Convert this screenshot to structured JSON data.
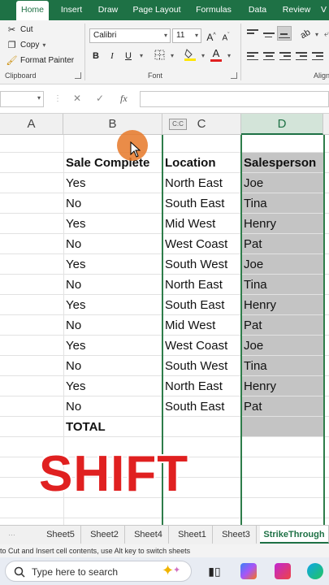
{
  "ribbon": {
    "tabs": [
      "Home",
      "Insert",
      "Draw",
      "Page Layout",
      "Formulas",
      "Data",
      "Review",
      "V"
    ],
    "active_tab": "Home",
    "clipboard": {
      "cut": "Cut",
      "copy": "Copy",
      "format_painter": "Format Painter",
      "label": "Clipboard"
    },
    "font": {
      "name": "Calibri",
      "size": "11",
      "label": "Font",
      "bold": "B",
      "italic": "I",
      "underline": "U",
      "grow": "A",
      "shrink": "A",
      "font_color": "A"
    },
    "alignment": {
      "label": "Align"
    },
    "colors": {
      "tabbar": "#1e7145",
      "font_color_bar": "#e02020",
      "highlight_bar": "#ffe600"
    }
  },
  "formula_bar": {
    "fx": "fx",
    "cancel": "✕",
    "enter": "✓",
    "value": ""
  },
  "columns": [
    "A",
    "B",
    "C",
    "D"
  ],
  "selected_column": "D",
  "paste_icon_label": "C:C",
  "table": {
    "headers": [
      "Sale Complete",
      "Location",
      "Salesperson"
    ],
    "rows": [
      [
        "Yes",
        "North East",
        "Joe"
      ],
      [
        "No",
        "South East",
        "Tina"
      ],
      [
        "Yes",
        "Mid West",
        "Henry"
      ],
      [
        "No",
        "West Coast",
        "Pat"
      ],
      [
        "Yes",
        "South West",
        "Joe"
      ],
      [
        "No",
        "North East",
        "Tina"
      ],
      [
        "Yes",
        "South East",
        "Henry"
      ],
      [
        "No",
        "Mid West",
        "Pat"
      ],
      [
        "Yes",
        "West Coast",
        "Joe"
      ],
      [
        "No",
        "South West",
        "Tina"
      ],
      [
        "Yes",
        "North East",
        "Henry"
      ],
      [
        "No",
        "South East",
        "Pat"
      ]
    ],
    "total_label": "TOTAL"
  },
  "overlay_caption": "SHIFT",
  "sheets": [
    "Sheet5",
    "Sheet2",
    "Sheet4",
    "Sheet1",
    "Sheet3",
    "StrikeThrough"
  ],
  "active_sheet": "StrikeThrough",
  "status_text": "to Cut and Insert cell contents, use Alt key to switch sheets",
  "taskbar": {
    "search_placeholder": "Type here to search",
    "icons": [
      "sparkles-icon",
      "task-view-icon",
      "copilot-icon",
      "paint-icon",
      "edge-icon"
    ]
  }
}
